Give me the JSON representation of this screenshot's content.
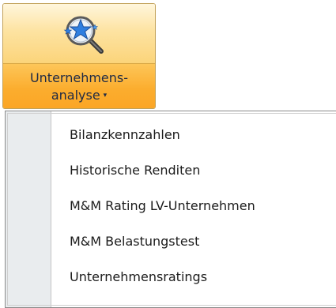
{
  "ribbon": {
    "button_label_line1": "Unternehmens-",
    "button_label_line2": "analyse",
    "caret": "▾",
    "icon": "magnifier-stars-icon",
    "colors": {
      "top": "#fde3a2",
      "bottom": "#fbad2e",
      "border": "#c2a25a"
    }
  },
  "menu": {
    "items": [
      {
        "label": "Bilanzkennzahlen"
      },
      {
        "label": "Historische Renditen"
      },
      {
        "label": "M&M Rating LV-Unternehmen"
      },
      {
        "label": "M&M Belastungstest"
      },
      {
        "label": "Unternehmensratings"
      }
    ]
  }
}
